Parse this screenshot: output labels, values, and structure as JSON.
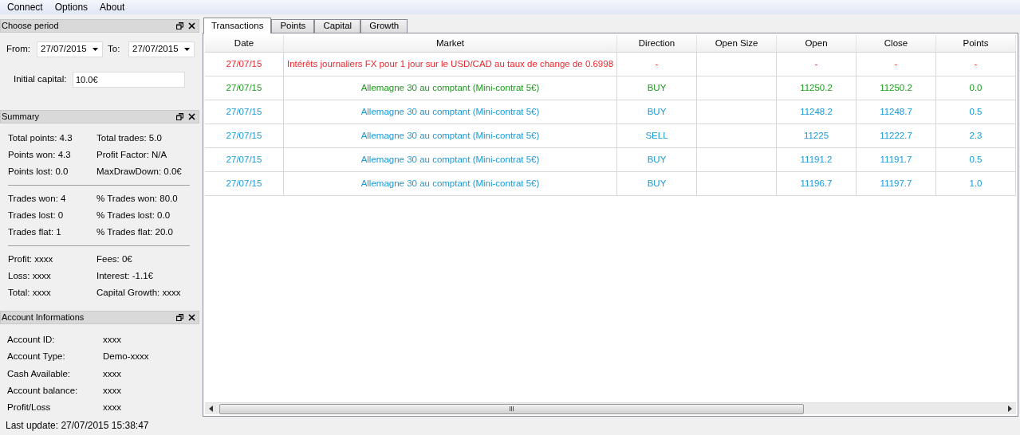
{
  "menu": [
    "Connect",
    "Options",
    "About"
  ],
  "choose_period": {
    "title": "Choose period",
    "from_label": "From:",
    "from_value": "27/07/2015",
    "to_label": "To:",
    "to_value": "27/07/2015",
    "capital_label": "Initial capital:",
    "capital_value": "10.0€"
  },
  "summary": {
    "title": "Summary",
    "groups": [
      [
        [
          "Total points: 4.3",
          "Total trades: 5.0"
        ],
        [
          "Points won: 4.3",
          "Profit Factor: N/A"
        ],
        [
          "Points lost: 0.0",
          "MaxDrawDown: 0.0€"
        ]
      ],
      [
        [
          "Trades won: 4",
          "% Trades won: 80.0"
        ],
        [
          "Trades lost: 0",
          "% Trades lost: 0.0"
        ],
        [
          "Trades flat: 1",
          "% Trades flat: 20.0"
        ]
      ],
      [
        [
          "Profit: xxxx",
          "Fees: 0€"
        ],
        [
          "Loss: xxxx",
          "Interest: -1.1€"
        ],
        [
          "Total: xxxx",
          "Capital Growth: xxxx"
        ]
      ]
    ]
  },
  "account": {
    "title": "Account Informations",
    "rows": [
      {
        "label": "Account ID:",
        "value": "xxxx"
      },
      {
        "label": "Account Type:",
        "value": "Demo-xxxx"
      },
      {
        "label": "Cash Available:",
        "value": "xxxx"
      },
      {
        "label": "Account balance:",
        "value": "xxxx"
      },
      {
        "label": "Profit/Loss",
        "value": "xxxx"
      }
    ]
  },
  "last_update": "Last update: 27/07/2015 15:38:47",
  "tabs": [
    {
      "label": "Transactions",
      "selected": true
    },
    {
      "label": "Points",
      "selected": false
    },
    {
      "label": "Capital",
      "selected": false
    },
    {
      "label": "Growth",
      "selected": false
    }
  ],
  "table": {
    "columns": [
      "Date",
      "Market",
      "Direction",
      "Open Size",
      "Open",
      "Close",
      "Points"
    ],
    "rows": [
      {
        "color": "#e8262b",
        "cells": [
          "27/07/15",
          "Intérêts journaliers FX pour 1 jour sur le USD/CAD au taux de change de 0.6998",
          "-",
          "",
          "-",
          "-",
          "-"
        ]
      },
      {
        "color": "#1e9a1e",
        "cells": [
          "27/07/15",
          "Allemagne 30 au comptant (Mini-contrat 5€)",
          "BUY",
          "",
          "11250.2",
          "11250.2",
          "0.0"
        ]
      },
      {
        "color": "#1a9ad6",
        "cells": [
          "27/07/15",
          "Allemagne 30 au comptant (Mini-contrat 5€)",
          "BUY",
          "",
          "11248.2",
          "11248.7",
          "0.5"
        ]
      },
      {
        "color": "#1a9ad6",
        "cells": [
          "27/07/15",
          "Allemagne 30 au comptant (Mini-contrat 5€)",
          "SELL",
          "",
          "11225",
          "11222.7",
          "2.3"
        ]
      },
      {
        "color": "#1a9ad6",
        "cells": [
          "27/07/15",
          "Allemagne 30 au comptant (Mini-contrat 5€)",
          "BUY",
          "",
          "11191.2",
          "11191.7",
          "0.5"
        ]
      },
      {
        "color": "#1a9ad6",
        "cells": [
          "27/07/15",
          "Allemagne 30 au comptant (Mini-contrat 5€)",
          "BUY",
          "",
          "11196.7",
          "11197.7",
          "1.0"
        ]
      }
    ]
  }
}
